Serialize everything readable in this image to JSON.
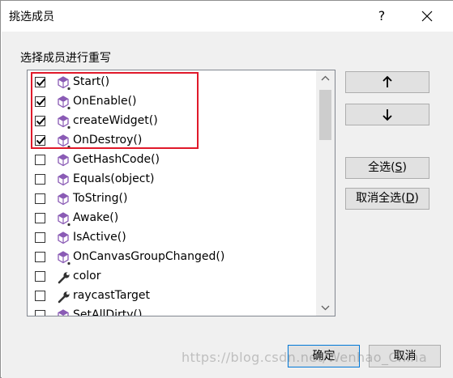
{
  "dialog": {
    "title": "挑选成员",
    "help": "?"
  },
  "group_label": "选择成员进行重写",
  "members": [
    {
      "label": "Start()",
      "checked": true,
      "icon": "method-virtual-icon"
    },
    {
      "label": "OnEnable()",
      "checked": true,
      "icon": "method-virtual-icon"
    },
    {
      "label": "createWidget()",
      "checked": true,
      "icon": "method-virtual-icon"
    },
    {
      "label": "OnDestroy()",
      "checked": true,
      "icon": "method-virtual-icon"
    },
    {
      "label": "GetHashCode()",
      "checked": false,
      "icon": "method-icon"
    },
    {
      "label": "Equals(object)",
      "checked": false,
      "icon": "method-icon"
    },
    {
      "label": "ToString()",
      "checked": false,
      "icon": "method-icon"
    },
    {
      "label": "Awake()",
      "checked": false,
      "icon": "method-virtual-icon"
    },
    {
      "label": "IsActive()",
      "checked": false,
      "icon": "method-icon"
    },
    {
      "label": "OnCanvasGroupChanged()",
      "checked": false,
      "icon": "method-virtual-icon"
    },
    {
      "label": "color",
      "checked": false,
      "icon": "property-wrench-icon"
    },
    {
      "label": "raycastTarget",
      "checked": false,
      "icon": "property-wrench-icon"
    },
    {
      "label": "SetAllDirty()",
      "checked": false,
      "icon": "method-icon"
    }
  ],
  "buttons": {
    "select_all": "全选",
    "select_all_key": "S",
    "unselect_all": "取消全选",
    "unselect_all_key": "D",
    "ok": "确定",
    "cancel": "取消"
  },
  "watermark": "https://blog.csdn.net/Wenhao_China",
  "colors": {
    "highlight": "#e0192a",
    "method_icon": "#8a5bb5",
    "dialog_bg": "#f0f0f0"
  }
}
